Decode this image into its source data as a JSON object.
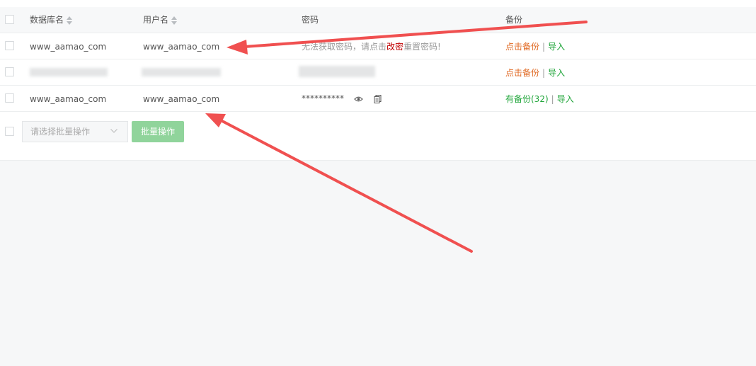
{
  "table": {
    "headers": {
      "db_name": "数据库名",
      "username": "用户名",
      "password": "密码",
      "backup": "备份"
    },
    "rows": [
      {
        "db_name": "www_aamao_com",
        "username": "www_aamao_com",
        "password_msg_pre": "无法获取密码，请点击",
        "password_msg_link": "改密",
        "password_msg_post": "重置密码!",
        "backup_label": "点击备份",
        "import_label": "导入",
        "separator": "|"
      },
      {
        "db_name": "",
        "username": "",
        "password": "",
        "backup_label": "点击备份",
        "import_label": "导入",
        "separator": "|"
      },
      {
        "db_name": "www_aamao_com",
        "username": "www_aamao_com",
        "password_masked": "**********",
        "backup_label": "有备份(32)",
        "import_label": "导入",
        "separator": "|"
      }
    ]
  },
  "batch": {
    "select_placeholder": "请选择批量操作",
    "button_label": "批量操作"
  },
  "icons": {
    "sort": "sort-icon",
    "eye": "eye-icon",
    "copy": "copy-icon",
    "chevron": "chevron-down-icon"
  },
  "colors": {
    "accent_green": "#20a53a",
    "button_disabled_green": "#90d49b",
    "warning_orange": "#e06a24",
    "link_red": "#c00000",
    "annotation_arrow": "#f05050"
  }
}
